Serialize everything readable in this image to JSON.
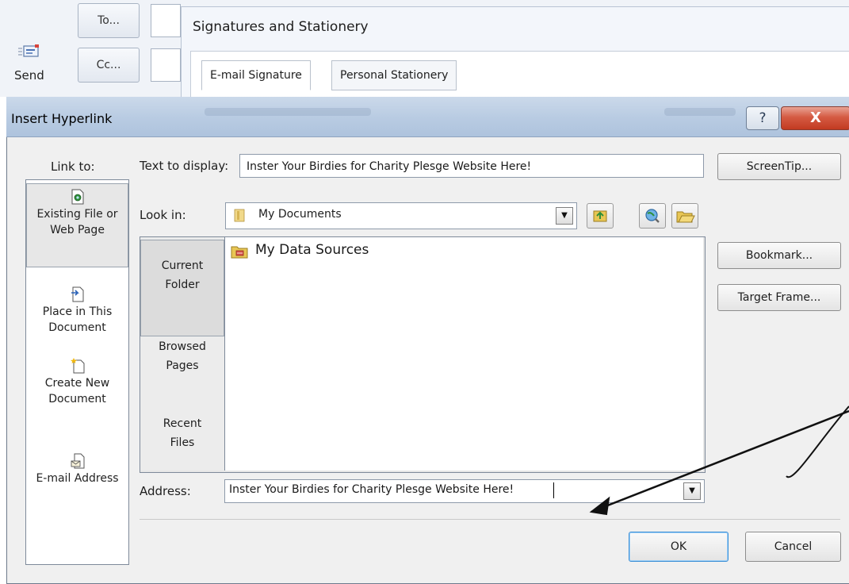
{
  "compose": {
    "send_label": "Send",
    "to_label": "To...",
    "cc_label": "Cc..."
  },
  "signatures_dialog": {
    "title": "Signatures and Stationery",
    "tabs": [
      {
        "label": "E-mail Signature",
        "active": true
      },
      {
        "label": "Personal Stationery",
        "active": false
      }
    ]
  },
  "dialog": {
    "title": "Insert Hyperlink",
    "help_glyph": "?",
    "close_glyph": "X"
  },
  "link_to": {
    "label": "Link to:",
    "items": [
      {
        "label": "Existing File or Web Page",
        "icon": "web-page-icon",
        "selected": true
      },
      {
        "label": "Place in This Document",
        "icon": "document-place-icon",
        "selected": false
      },
      {
        "label": "Create New Document",
        "icon": "new-document-icon",
        "selected": false
      },
      {
        "label": "E-mail Address",
        "icon": "email-address-icon",
        "selected": false
      }
    ]
  },
  "text_to_display": {
    "label": "Text to display:",
    "value": "Inster Your Birdies for Charity Plesge Website Here!"
  },
  "screentip_label": "ScreenTip...",
  "look_in": {
    "label": "Look in:",
    "value": "My Documents"
  },
  "browse_nav": [
    {
      "label_line1": "Current",
      "label_line2": "Folder",
      "selected": true
    },
    {
      "label_line1": "Browsed",
      "label_line2": "Pages",
      "selected": false
    },
    {
      "label_line1": "Recent",
      "label_line2": "Files",
      "selected": false
    }
  ],
  "files": [
    {
      "name": "My Data Sources",
      "icon": "data-source-folder-icon"
    }
  ],
  "side_buttons": {
    "bookmark": "Bookmark...",
    "target_frame": "Target Frame..."
  },
  "address": {
    "label": "Address:",
    "value": "Inster Your Birdies for Charity Plesge Website Here!"
  },
  "buttons": {
    "ok": "OK",
    "cancel": "Cancel"
  }
}
